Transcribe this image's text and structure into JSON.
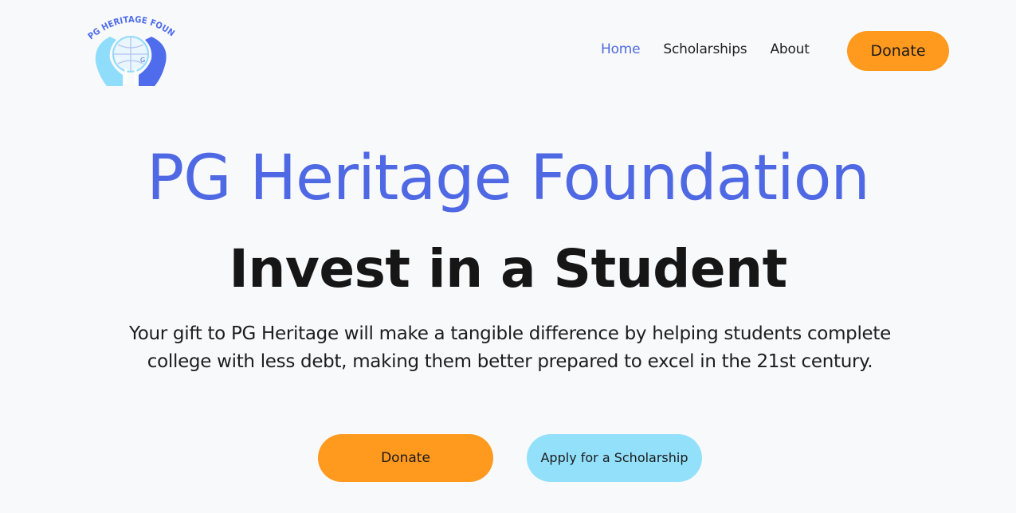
{
  "logo": {
    "text": "PG HERITAGE FOUNDATION",
    "colors": {
      "hand_light": "#8fdcfb",
      "hand_dark": "#4e6cec",
      "text": "#4e6cec"
    }
  },
  "nav": {
    "items": [
      {
        "label": "Home",
        "active": true
      },
      {
        "label": "Scholarships",
        "active": false
      },
      {
        "label": "About",
        "active": false
      }
    ],
    "donate_label": "Donate"
  },
  "hero": {
    "title": "PG Heritage Foundation",
    "subtitle": "Invest in a Student",
    "description": "Your gift to PG Heritage will make a tangible difference by helping students complete college with less debt, making them better prepared to excel in the 21st century.",
    "cta_donate": "Donate",
    "cta_apply": "Apply for a Scholarship"
  },
  "colors": {
    "brand_blue": "#4f68e3",
    "accent_orange": "#ff9a1f",
    "accent_light_blue": "#93e0fb",
    "background": "#f8f9fb"
  }
}
